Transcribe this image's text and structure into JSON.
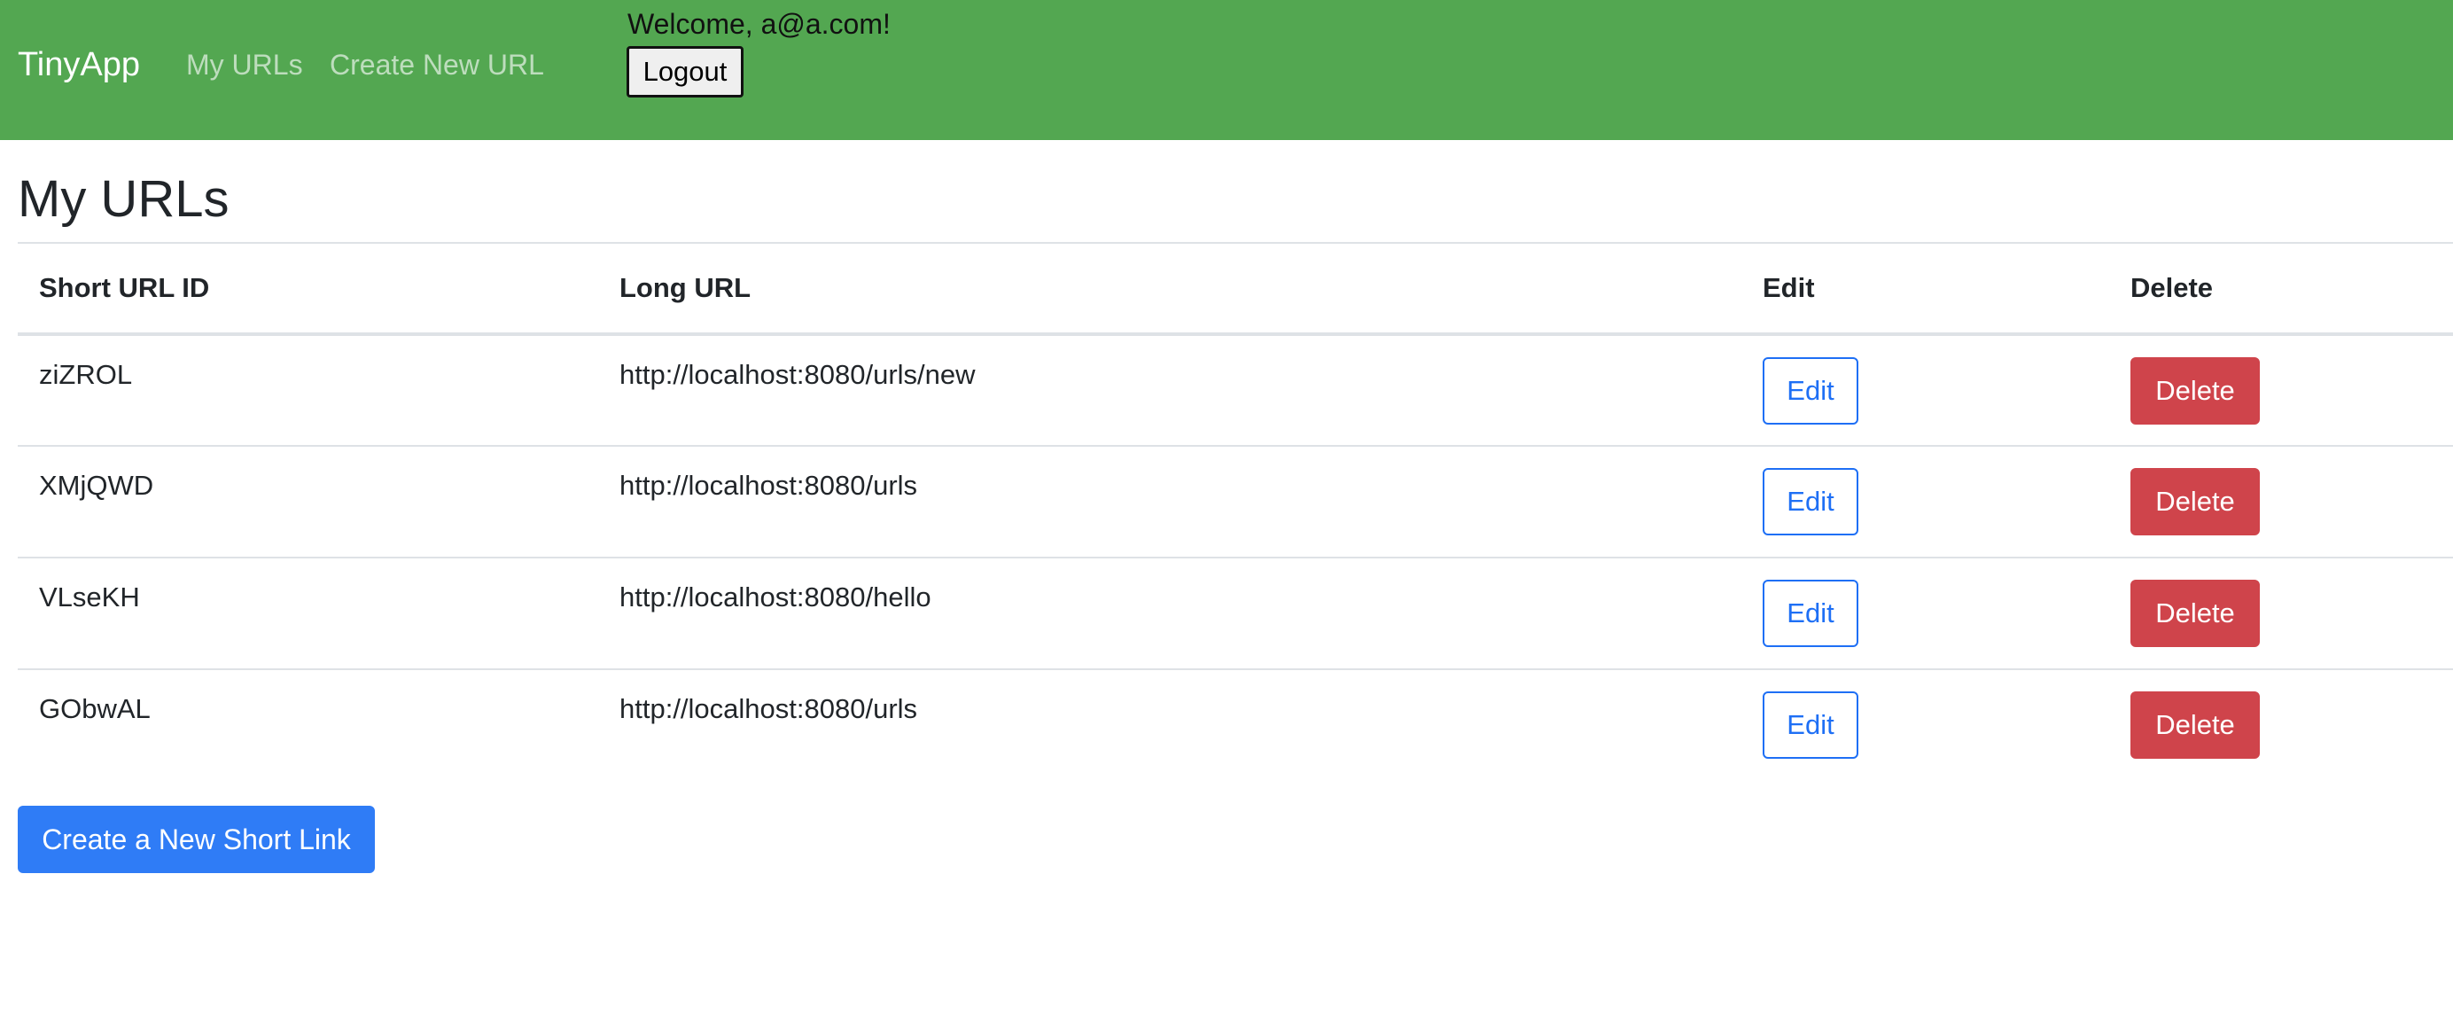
{
  "header": {
    "brand": "TinyApp",
    "nav": [
      {
        "label": "My URLs"
      },
      {
        "label": "Create New URL"
      }
    ],
    "welcome": "Welcome, a@a.com!",
    "logout_label": "Logout"
  },
  "main": {
    "title": "My URLs",
    "table": {
      "columns": [
        "Short URL ID",
        "Long URL",
        "Edit",
        "Delete"
      ],
      "rows": [
        {
          "id": "ziZROL",
          "long_url": "http://localhost:8080/urls/new",
          "edit_label": "Edit",
          "delete_label": "Delete"
        },
        {
          "id": "XMjQWD",
          "long_url": "http://localhost:8080/urls",
          "edit_label": "Edit",
          "delete_label": "Delete"
        },
        {
          "id": "VLseKH",
          "long_url": "http://localhost:8080/hello",
          "edit_label": "Edit",
          "delete_label": "Delete"
        },
        {
          "id": "GObwAL",
          "long_url": "http://localhost:8080/urls",
          "edit_label": "Edit",
          "delete_label": "Delete"
        }
      ]
    },
    "create_button_label": "Create a New Short Link"
  },
  "colors": {
    "navbar": "#53a751",
    "edit_outline": "#1e6ff5",
    "delete": "#cf444b",
    "primary": "#2f7cf6"
  }
}
